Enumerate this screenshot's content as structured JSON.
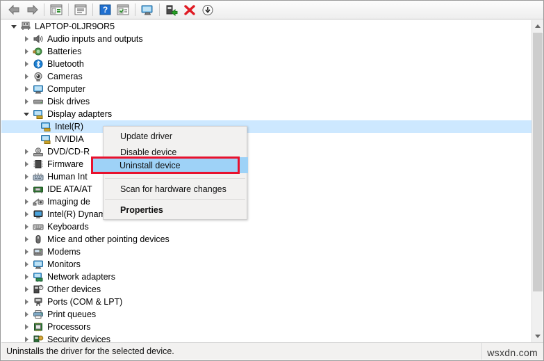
{
  "toolbar": {
    "buttons": [
      {
        "name": "back-button",
        "icon": "back-arrow-icon",
        "label": "Back"
      },
      {
        "name": "forward-button",
        "icon": "forward-arrow-icon",
        "label": "Forward"
      },
      {
        "name": "show-hide-console-tree-button",
        "icon": "console-tree-icon",
        "label": "Show/hide console tree"
      },
      {
        "name": "properties-button",
        "icon": "properties-icon",
        "label": "Properties"
      },
      {
        "name": "help-button",
        "icon": "help-question-icon",
        "label": "Help"
      },
      {
        "name": "update-driver-button",
        "icon": "update-driver-icon",
        "label": "Update driver"
      },
      {
        "name": "scan-hardware-button",
        "icon": "monitor-scan-icon",
        "label": "Scan for hardware changes"
      },
      {
        "name": "enable-device-button",
        "icon": "enable-device-icon",
        "label": "Enable device"
      },
      {
        "name": "uninstall-device-button",
        "icon": "red-x-icon",
        "label": "Uninstall device"
      },
      {
        "name": "disable-device-button",
        "icon": "down-arrow-circle-icon",
        "label": "Disable device"
      }
    ]
  },
  "tree": {
    "root": {
      "label": "LAPTOP-0LJR9OR5",
      "icon": "computer-root-icon",
      "expanded": true
    },
    "items": [
      {
        "label": "Audio inputs and outputs",
        "icon": "speaker-icon",
        "indent": 1,
        "expanded": false
      },
      {
        "label": "Batteries",
        "icon": "battery-icon",
        "indent": 1,
        "expanded": false
      },
      {
        "label": "Bluetooth",
        "icon": "bluetooth-icon",
        "indent": 1,
        "expanded": false
      },
      {
        "label": "Cameras",
        "icon": "camera-icon",
        "indent": 1,
        "expanded": false
      },
      {
        "label": "Computer",
        "icon": "computer-icon",
        "indent": 1,
        "expanded": false
      },
      {
        "label": "Disk drives",
        "icon": "disk-drive-icon",
        "indent": 1,
        "expanded": false
      },
      {
        "label": "Display adapters",
        "icon": "display-adapter-icon",
        "indent": 1,
        "expanded": true
      },
      {
        "label": "Intel(R)",
        "icon": "display-adapter-icon",
        "indent": 2,
        "selected": true
      },
      {
        "label": "NVIDIA",
        "icon": "display-adapter-icon",
        "indent": 2
      },
      {
        "label": "DVD/CD-R",
        "icon": "dvd-drive-icon",
        "indent": 1,
        "expanded": false
      },
      {
        "label": "Firmware",
        "icon": "firmware-chip-icon",
        "indent": 1,
        "expanded": false
      },
      {
        "label": "Human Int",
        "icon": "hid-keyboard-icon",
        "indent": 1,
        "expanded": false
      },
      {
        "label": "IDE ATA/AT",
        "icon": "ide-controller-icon",
        "indent": 1,
        "expanded": false
      },
      {
        "label": "Imaging de",
        "icon": "imaging-device-icon",
        "indent": 1,
        "expanded": false
      },
      {
        "label": "Intel(R) Dynamic Platform and Thermal Framework",
        "icon": "thermal-framework-icon",
        "indent": 1,
        "expanded": false
      },
      {
        "label": "Keyboards",
        "icon": "keyboard-icon",
        "indent": 1,
        "expanded": false
      },
      {
        "label": "Mice and other pointing devices",
        "icon": "mouse-icon",
        "indent": 1,
        "expanded": false
      },
      {
        "label": "Modems",
        "icon": "modem-icon",
        "indent": 1,
        "expanded": false
      },
      {
        "label": "Monitors",
        "icon": "monitor-icon",
        "indent": 1,
        "expanded": false
      },
      {
        "label": "Network adapters",
        "icon": "network-adapter-icon",
        "indent": 1,
        "expanded": false
      },
      {
        "label": "Other devices",
        "icon": "other-device-icon",
        "indent": 1,
        "expanded": false
      },
      {
        "label": "Ports (COM & LPT)",
        "icon": "port-icon",
        "indent": 1,
        "expanded": false
      },
      {
        "label": "Print queues",
        "icon": "printer-icon",
        "indent": 1,
        "expanded": false
      },
      {
        "label": "Processors",
        "icon": "processor-icon",
        "indent": 1,
        "expanded": false
      },
      {
        "label": "Security devices",
        "icon": "security-device-icon",
        "indent": 1,
        "expanded": false
      }
    ]
  },
  "context_menu": {
    "items": [
      {
        "label": "Update driver",
        "type": "item",
        "highlighted": false
      },
      {
        "label": "Disable device",
        "type": "item",
        "highlighted": false
      },
      {
        "label": "Uninstall device",
        "type": "item",
        "highlighted": true
      },
      {
        "label": "",
        "type": "separator"
      },
      {
        "label": "Scan for hardware changes",
        "type": "item",
        "highlighted": false
      },
      {
        "label": "",
        "type": "separator"
      },
      {
        "label": "Properties",
        "type": "item-bold",
        "highlighted": false
      }
    ]
  },
  "statusbar": {
    "message": "Uninstalls the driver for the selected device."
  },
  "watermark": {
    "text": "wsxdn.com"
  },
  "scrollbar": {
    "up_arrow": "scroll-up-icon",
    "down_arrow": "scroll-down-icon"
  },
  "colors": {
    "selection": "#cde8ff",
    "menu_highlight": "#9ed2f7",
    "annotation_red": "#e8112d",
    "toolbar_bg": "#f4f4f4"
  }
}
